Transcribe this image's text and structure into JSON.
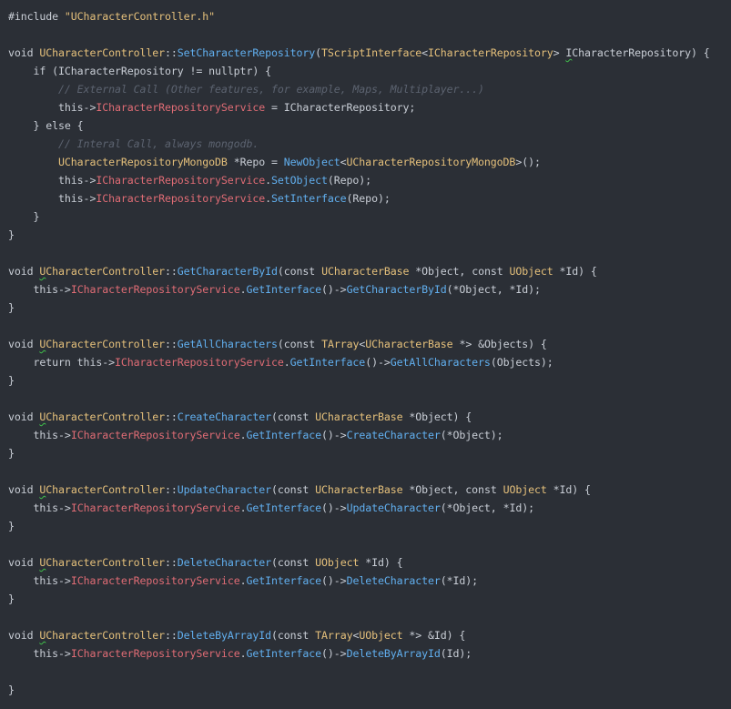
{
  "colors": {
    "background": "#2b2f36",
    "plain": "#c9ced6",
    "keyword": "#c9ced6",
    "function_name": "#61afef",
    "type_name": "#e5c07b",
    "member_field": "#e06c75",
    "comment": "#5c6370",
    "string": "#e5c07b",
    "squiggle": "#3fbf4a"
  },
  "lines": [
    [
      [
        "plain",
        "#include "
      ],
      [
        "string",
        "\"UCharacterController.h\""
      ]
    ],
    [],
    [
      [
        "plain",
        "void "
      ],
      [
        "type_name",
        "UCharacterController"
      ],
      [
        "plain",
        "::"
      ],
      [
        "function_name",
        "SetCharacterRepository"
      ],
      [
        "plain",
        "("
      ],
      [
        "type_name",
        "TScriptInterface"
      ],
      [
        "plain",
        "<"
      ],
      [
        "type_name",
        "ICharacterRepository"
      ],
      [
        "plain",
        "> "
      ],
      [
        "squiggle",
        "I"
      ],
      [
        "plain",
        "CharacterRepository) {"
      ]
    ],
    [
      [
        "plain",
        "    if (ICharacterRepository != nullptr) {"
      ]
    ],
    [
      [
        "comment",
        "        // External Call (Other features, for example, Maps, Multiplayer...)"
      ]
    ],
    [
      [
        "plain",
        "        this->"
      ],
      [
        "member_field",
        "ICharacterRepositoryService"
      ],
      [
        "plain",
        " = ICharacterRepository;"
      ]
    ],
    [
      [
        "plain",
        "    } else {"
      ]
    ],
    [
      [
        "comment",
        "        // Interal Call, always mongodb."
      ]
    ],
    [
      [
        "plain",
        "        "
      ],
      [
        "type_name",
        "UCharacterRepositoryMongoDB"
      ],
      [
        "plain",
        " *Repo = "
      ],
      [
        "function_name",
        "NewObject"
      ],
      [
        "plain",
        "<"
      ],
      [
        "type_name",
        "UCharacterRepositoryMongoDB"
      ],
      [
        "plain",
        ">();"
      ]
    ],
    [
      [
        "plain",
        "        this->"
      ],
      [
        "member_field",
        "ICharacterRepositoryService"
      ],
      [
        "plain",
        "."
      ],
      [
        "function_name",
        "SetObject"
      ],
      [
        "plain",
        "(Repo);"
      ]
    ],
    [
      [
        "plain",
        "        this->"
      ],
      [
        "member_field",
        "ICharacterRepositoryService"
      ],
      [
        "plain",
        "."
      ],
      [
        "function_name",
        "SetInterface"
      ],
      [
        "plain",
        "(Repo);"
      ]
    ],
    [
      [
        "plain",
        "    }"
      ]
    ],
    [
      [
        "plain",
        "}"
      ]
    ],
    [],
    [
      [
        "plain",
        "void "
      ],
      [
        "squiggle_type",
        "U"
      ],
      [
        "type_name",
        "CharacterController"
      ],
      [
        "plain",
        "::"
      ],
      [
        "function_name",
        "GetCharacterById"
      ],
      [
        "plain",
        "(const "
      ],
      [
        "type_name",
        "UCharacterBase"
      ],
      [
        "plain",
        " *Object, const "
      ],
      [
        "type_name",
        "UObject"
      ],
      [
        "plain",
        " *Id) {"
      ]
    ],
    [
      [
        "plain",
        "    this->"
      ],
      [
        "member_field",
        "ICharacterRepositoryService"
      ],
      [
        "plain",
        "."
      ],
      [
        "function_name",
        "GetInterface"
      ],
      [
        "plain",
        "()->"
      ],
      [
        "function_name",
        "GetCharacterById"
      ],
      [
        "plain",
        "(*Object, *Id);"
      ]
    ],
    [
      [
        "plain",
        "}"
      ]
    ],
    [],
    [
      [
        "plain",
        "void "
      ],
      [
        "squiggle_type",
        "U"
      ],
      [
        "type_name",
        "CharacterController"
      ],
      [
        "plain",
        "::"
      ],
      [
        "function_name",
        "GetAllCharacters"
      ],
      [
        "plain",
        "(const "
      ],
      [
        "type_name",
        "TArray"
      ],
      [
        "plain",
        "<"
      ],
      [
        "type_name",
        "UCharacterBase"
      ],
      [
        "plain",
        " *> &Objects) {"
      ]
    ],
    [
      [
        "plain",
        "    return this->"
      ],
      [
        "member_field",
        "ICharacterRepositoryService"
      ],
      [
        "plain",
        "."
      ],
      [
        "function_name",
        "GetInterface"
      ],
      [
        "plain",
        "()->"
      ],
      [
        "function_name",
        "GetAllCharacters"
      ],
      [
        "plain",
        "(Objects);"
      ]
    ],
    [
      [
        "plain",
        "}"
      ]
    ],
    [],
    [
      [
        "plain",
        "void "
      ],
      [
        "squiggle_type",
        "U"
      ],
      [
        "type_name",
        "CharacterController"
      ],
      [
        "plain",
        "::"
      ],
      [
        "function_name",
        "CreateCharacter"
      ],
      [
        "plain",
        "(const "
      ],
      [
        "type_name",
        "UCharacterBase"
      ],
      [
        "plain",
        " *Object) {"
      ]
    ],
    [
      [
        "plain",
        "    this->"
      ],
      [
        "member_field",
        "ICharacterRepositoryService"
      ],
      [
        "plain",
        "."
      ],
      [
        "function_name",
        "GetInterface"
      ],
      [
        "plain",
        "()->"
      ],
      [
        "function_name",
        "CreateCharacter"
      ],
      [
        "plain",
        "(*Object);"
      ]
    ],
    [
      [
        "plain",
        "}"
      ]
    ],
    [],
    [
      [
        "plain",
        "void "
      ],
      [
        "squiggle_type",
        "U"
      ],
      [
        "type_name",
        "CharacterController"
      ],
      [
        "plain",
        "::"
      ],
      [
        "function_name",
        "UpdateCharacter"
      ],
      [
        "plain",
        "(const "
      ],
      [
        "type_name",
        "UCharacterBase"
      ],
      [
        "plain",
        " *Object, const "
      ],
      [
        "type_name",
        "UObject"
      ],
      [
        "plain",
        " *Id) {"
      ]
    ],
    [
      [
        "plain",
        "    this->"
      ],
      [
        "member_field",
        "ICharacterRepositoryService"
      ],
      [
        "plain",
        "."
      ],
      [
        "function_name",
        "GetInterface"
      ],
      [
        "plain",
        "()->"
      ],
      [
        "function_name",
        "UpdateCharacter"
      ],
      [
        "plain",
        "(*Object, *Id);"
      ]
    ],
    [
      [
        "plain",
        "}"
      ]
    ],
    [],
    [
      [
        "plain",
        "void "
      ],
      [
        "squiggle_type",
        "U"
      ],
      [
        "type_name",
        "CharacterController"
      ],
      [
        "plain",
        "::"
      ],
      [
        "function_name",
        "DeleteCharacter"
      ],
      [
        "plain",
        "(const "
      ],
      [
        "type_name",
        "UObject"
      ],
      [
        "plain",
        " *Id) {"
      ]
    ],
    [
      [
        "plain",
        "    this->"
      ],
      [
        "member_field",
        "ICharacterRepositoryService"
      ],
      [
        "plain",
        "."
      ],
      [
        "function_name",
        "GetInterface"
      ],
      [
        "plain",
        "()->"
      ],
      [
        "function_name",
        "DeleteCharacter"
      ],
      [
        "plain",
        "(*Id);"
      ]
    ],
    [
      [
        "plain",
        "}"
      ]
    ],
    [],
    [
      [
        "plain",
        "void "
      ],
      [
        "squiggle_type",
        "U"
      ],
      [
        "type_name",
        "CharacterController"
      ],
      [
        "plain",
        "::"
      ],
      [
        "function_name",
        "DeleteByArrayId"
      ],
      [
        "plain",
        "(const "
      ],
      [
        "type_name",
        "TArray"
      ],
      [
        "plain",
        "<"
      ],
      [
        "type_name",
        "UObject"
      ],
      [
        "plain",
        " *> &Id) {"
      ]
    ],
    [
      [
        "plain",
        "    this->"
      ],
      [
        "member_field",
        "ICharacterRepositoryService"
      ],
      [
        "plain",
        "."
      ],
      [
        "function_name",
        "GetInterface"
      ],
      [
        "plain",
        "()->"
      ],
      [
        "function_name",
        "DeleteByArrayId"
      ],
      [
        "plain",
        "(Id);"
      ]
    ],
    [],
    [
      [
        "plain",
        "}"
      ]
    ]
  ]
}
